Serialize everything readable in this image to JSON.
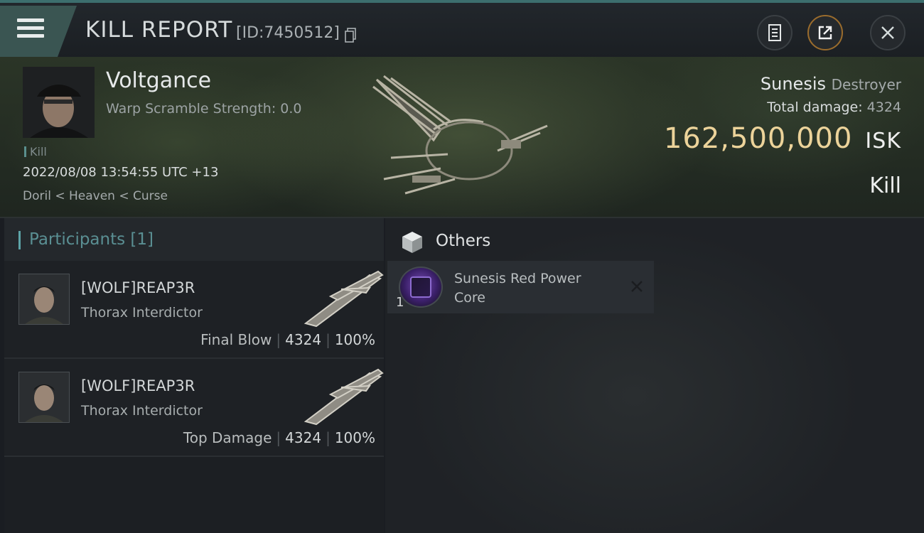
{
  "header": {
    "title": "KILL REPORT",
    "report_id": "[ID:7450512]",
    "icons": {
      "menu": "hamburger-menu-icon",
      "copy": "copy-icon",
      "clipboard": "clipboard-icon",
      "share": "share-icon",
      "close": "close-icon"
    }
  },
  "victim": {
    "name": "Voltgance",
    "subtitle": "Warp Scramble Strength: 0.0",
    "tag": "Kill",
    "datetime": "2022/08/08 13:54:55 UTC +13",
    "location": "Doril < Heaven < Curse",
    "ship": "Sunesis",
    "ship_class": "Destroyer",
    "total_damage_label": "Total damage:",
    "total_damage": "4324",
    "isk_value": "162,500,000",
    "isk_unit": "ISK",
    "outcome": "Kill"
  },
  "participants": {
    "label": "Participants [1]",
    "rows": [
      {
        "name": "[WOLF]REAP3R",
        "ship": "Thorax Interdictor",
        "role": "Final Blow",
        "damage": "4324",
        "percent": "100%"
      },
      {
        "name": "[WOLF]REAP3R",
        "ship": "Thorax Interdictor",
        "role": "Top Damage",
        "damage": "4324",
        "percent": "100%"
      }
    ]
  },
  "others": {
    "label": "Others",
    "items": [
      {
        "name": "Sunesis Red Power Core",
        "qty": "1"
      }
    ]
  },
  "colors": {
    "accent_teal": "#5da4a8",
    "isk_gold": "#ecd39a",
    "menu_tab": "#3a5552"
  }
}
